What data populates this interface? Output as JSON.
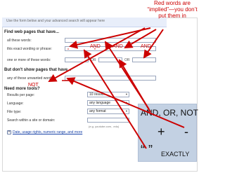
{
  "top_hint": "Use the form below and your advanced search will appear here",
  "callout": {
    "text": "Red words are “implied”—you don’t put them in"
  },
  "find_section": {
    "title": "Find web pages that have...",
    "rows": [
      {
        "label": "all these words:"
      },
      {
        "label": "this exact wording or phrase:"
      },
      {
        "label": "one or more of these words:",
        "or1": "OR",
        "or2": "OR"
      }
    ]
  },
  "dont_section": {
    "title": "But don't show pages that have...",
    "rows": [
      {
        "label": "any of these unwanted words:"
      }
    ]
  },
  "more_section": {
    "title": "Need more tools?",
    "rows": [
      {
        "label": "Results per page:",
        "value": "10 results"
      },
      {
        "label": "Language:",
        "value": "any language"
      },
      {
        "label": "File type:",
        "value": "any format"
      },
      {
        "label": "Search within a site or domain:",
        "value": ""
      }
    ],
    "example": "(e.g. youtube.com, .edu)",
    "link": "Date, usage rights, numeric range, and more"
  },
  "annotations": {
    "and1": "AND",
    "and2": "AND",
    "and3": "AND",
    "quote_open": "“",
    "quote_close": "”",
    "minus": "–",
    "not": "NOT"
  },
  "summary": {
    "title": "AND, OR, NOT",
    "plus": "+",
    "minus": "-",
    "quotes": "“  ”",
    "exactly": "EXACTLY"
  },
  "colors": {
    "annotation": "#cc0000",
    "panel_bg": "#c3d1e3",
    "link": "#1a44a8"
  }
}
